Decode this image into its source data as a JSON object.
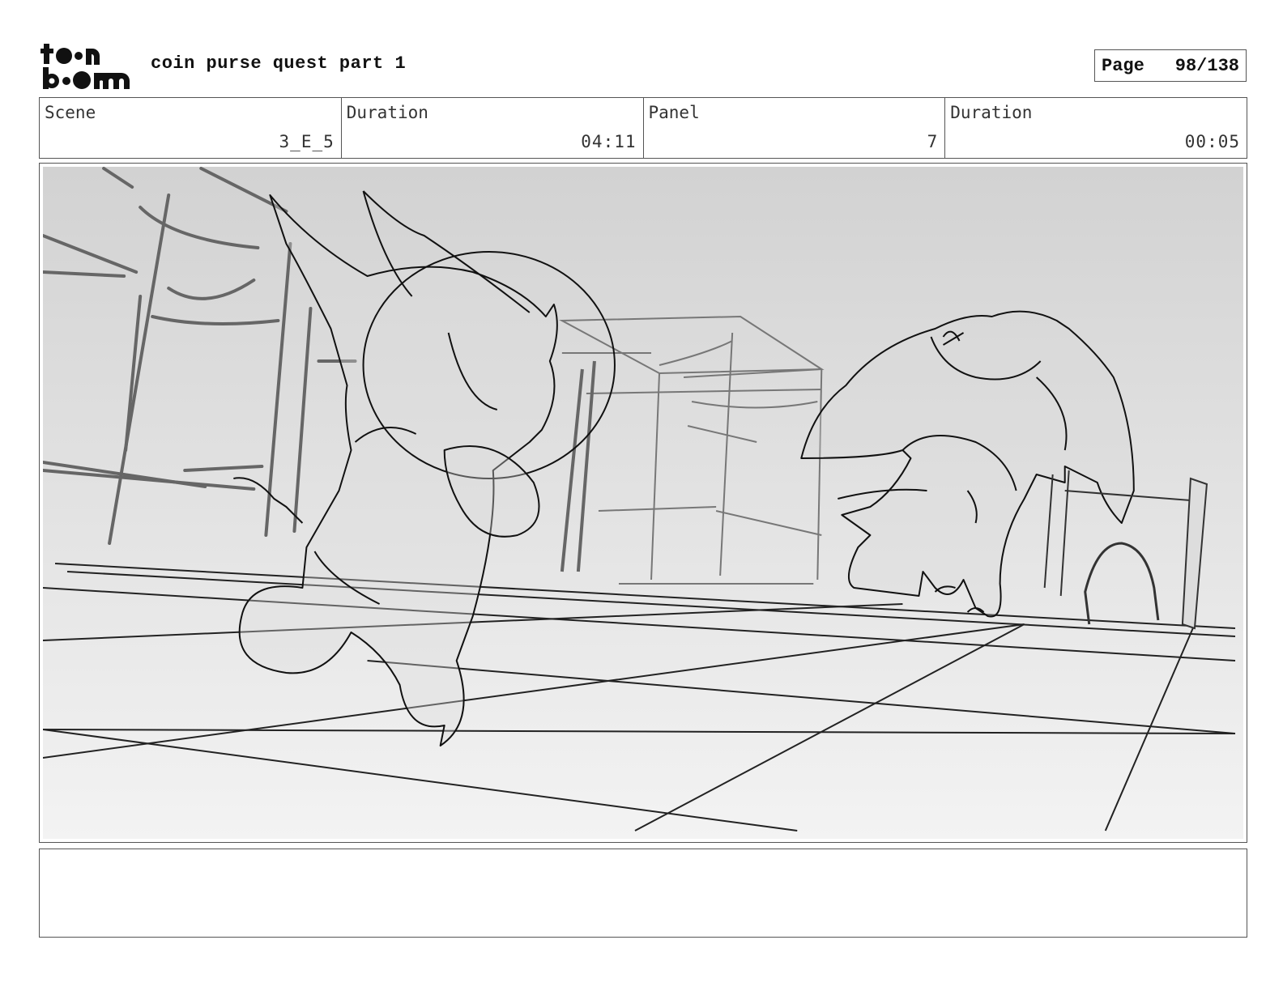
{
  "header": {
    "logo_text": "toon boom",
    "title": "coin purse quest part 1",
    "page_label": "Page",
    "page_number": "98/138"
  },
  "info": {
    "scene_label": "Scene",
    "scene_value": "3_E_5",
    "duration_label": "Duration",
    "duration_value": "04:11",
    "panel_label": "Panel",
    "panel_value": "7",
    "panel_duration_label": "Duration",
    "panel_duration_value": "00:05"
  },
  "notes": {
    "text": ""
  }
}
